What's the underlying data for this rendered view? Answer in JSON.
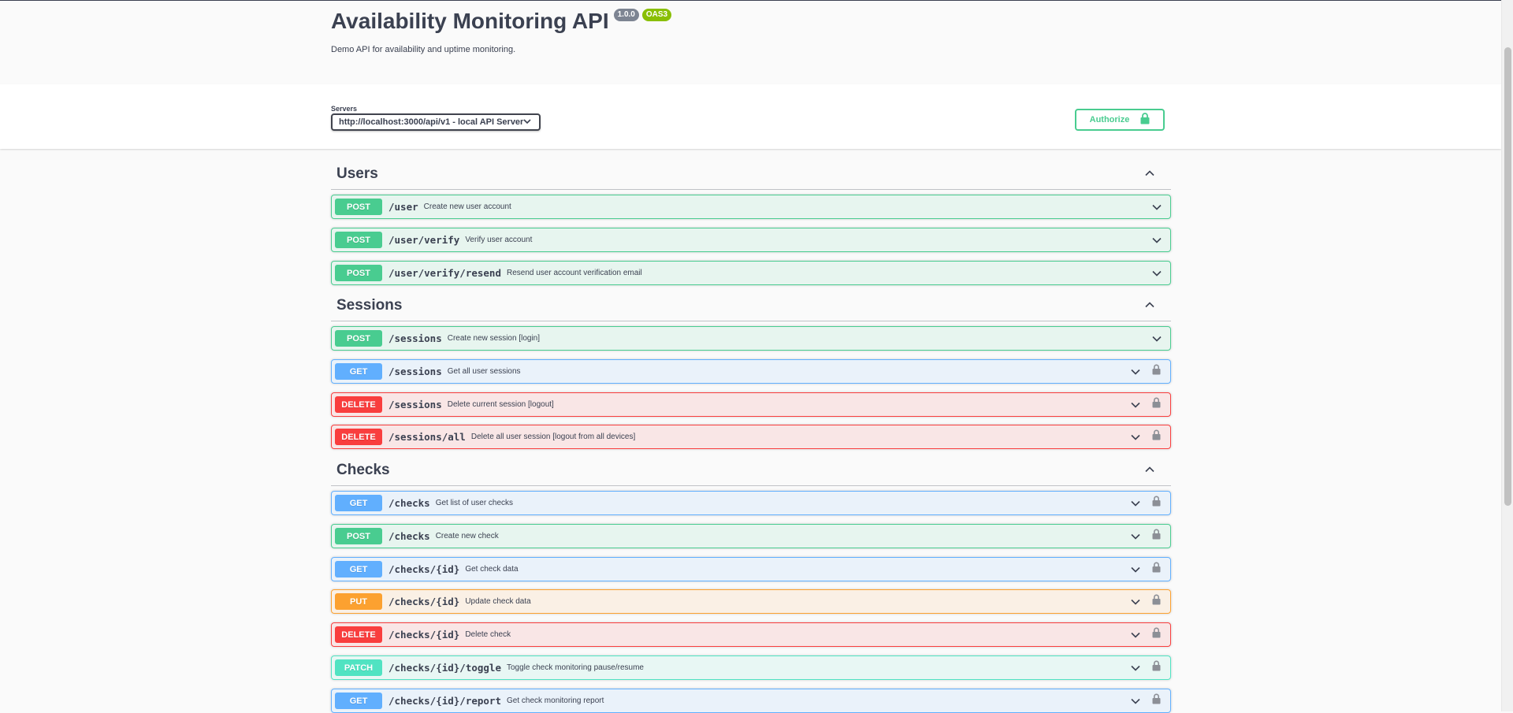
{
  "info": {
    "title": "Availability Monitoring API",
    "version": "1.0.0",
    "oas_badge": "OAS3",
    "description": "Demo API for availability and uptime monitoring."
  },
  "servers": {
    "label": "Servers",
    "selected": "http://localhost:3000/api/v1 - local API Server"
  },
  "authorize": {
    "label": "Authorize"
  },
  "colors": {
    "post": "#49cc90",
    "get": "#61affe",
    "delete": "#f93e3e",
    "put": "#fca130",
    "patch": "#50e3c2"
  },
  "tags": [
    {
      "name": "Users",
      "operations": [
        {
          "method": "POST",
          "path": "/user",
          "summary": "Create new user account",
          "locked": false
        },
        {
          "method": "POST",
          "path": "/user/verify",
          "summary": "Verify user account",
          "locked": false
        },
        {
          "method": "POST",
          "path": "/user/verify/resend",
          "summary": "Resend user account verification email",
          "locked": false
        }
      ]
    },
    {
      "name": "Sessions",
      "operations": [
        {
          "method": "POST",
          "path": "/sessions",
          "summary": "Create new session [login]",
          "locked": false
        },
        {
          "method": "GET",
          "path": "/sessions",
          "summary": "Get all user sessions",
          "locked": true
        },
        {
          "method": "DELETE",
          "path": "/sessions",
          "summary": "Delete current session [logout]",
          "locked": true
        },
        {
          "method": "DELETE",
          "path": "/sessions/all",
          "summary": "Delete all user session [logout from all devices]",
          "locked": true
        }
      ]
    },
    {
      "name": "Checks",
      "operations": [
        {
          "method": "GET",
          "path": "/checks",
          "summary": "Get list of user checks",
          "locked": true
        },
        {
          "method": "POST",
          "path": "/checks",
          "summary": "Create new check",
          "locked": true
        },
        {
          "method": "GET",
          "path": "/checks/{id}",
          "summary": "Get check data",
          "locked": true
        },
        {
          "method": "PUT",
          "path": "/checks/{id}",
          "summary": "Update check data",
          "locked": true
        },
        {
          "method": "DELETE",
          "path": "/checks/{id}",
          "summary": "Delete check",
          "locked": true
        },
        {
          "method": "PATCH",
          "path": "/checks/{id}/toggle",
          "summary": "Toggle check monitoring pause/resume",
          "locked": true
        },
        {
          "method": "GET",
          "path": "/checks/{id}/report",
          "summary": "Get check monitoring report",
          "locked": true
        }
      ]
    }
  ]
}
